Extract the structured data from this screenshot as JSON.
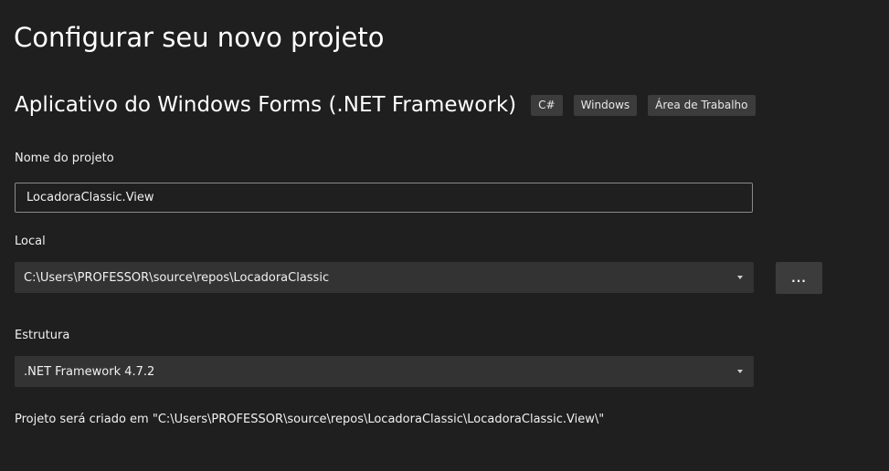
{
  "page": {
    "title": "Configurar seu novo projeto"
  },
  "template": {
    "name": "Aplicativo do Windows Forms (.NET Framework)",
    "tags": [
      "C#",
      "Windows",
      "Área de Trabalho"
    ]
  },
  "project_name": {
    "label": "Nome do projeto",
    "value": "LocadoraClassic.View"
  },
  "location": {
    "label": "Local",
    "value": "C:\\Users\\PROFESSOR\\source\\repos\\LocadoraClassic",
    "browse_label": "..."
  },
  "framework": {
    "label": "Estrutura",
    "value": ".NET Framework 4.7.2"
  },
  "footer": {
    "path_text": "Projeto será criado em \"C:\\Users\\PROFESSOR\\source\\repos\\LocadoraClassic\\LocadoraClassic.View\\\""
  }
}
